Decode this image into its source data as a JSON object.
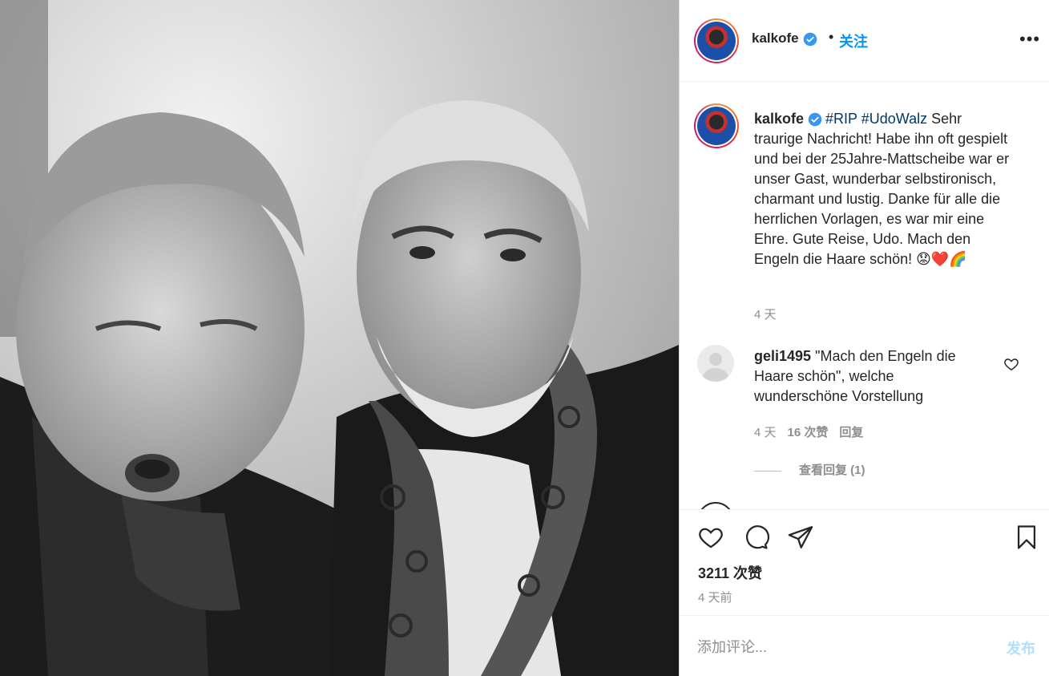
{
  "header": {
    "username": "kalkofe",
    "follow_label": "关注",
    "separator": "•"
  },
  "caption": {
    "username": "kalkofe",
    "hashtags": "#RIP #UdoWalz",
    "text": "Sehr traurige Nachricht! Habe ihn oft gespielt und bei der 25Jahre-Mattscheibe war er unser Gast, wunderbar selbstironisch, charmant und lustig. Danke für alle die herrlichen Vorlagen, es war mir eine Ehre. Gute Reise, Udo. Mach den Engeln die Haare schön! 😟❤️🌈",
    "time": "4 天"
  },
  "comment": {
    "username": "geli1495",
    "text": "\"Mach den Engeln die Haare schön\", welche wunderschöne Vorstellung",
    "time": "4 天",
    "likes": "16 次赞",
    "reply_label": "回复",
    "view_replies": "查看回复 (1)"
  },
  "actions": {
    "likes": "3211 次赞",
    "posted": "4 天前"
  },
  "comment_box": {
    "placeholder": "添加评论...",
    "post_label": "发布"
  },
  "colors": {
    "link": "#0095f6",
    "hashtag": "#00376b",
    "muted": "#8e8e8e",
    "post_disabled": "#b2dffc"
  }
}
